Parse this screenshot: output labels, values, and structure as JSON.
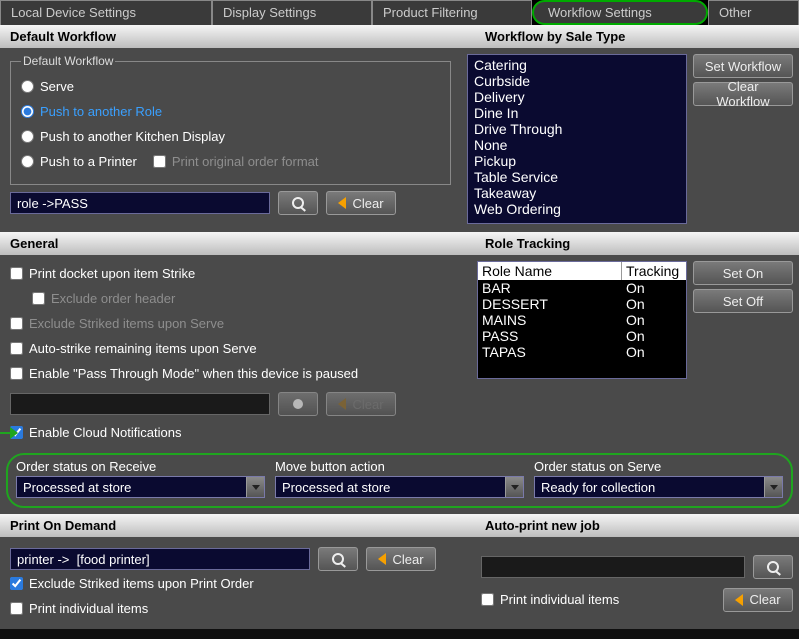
{
  "tabs": {
    "t0": "Local Device Settings",
    "t1": "Display Settings",
    "t2": "Product Filtering",
    "t3": "Workflow Settings",
    "t4": "Other"
  },
  "headers": {
    "default_workflow": "Default Workflow",
    "workflow_by_sale_type": "Workflow by Sale Type",
    "general": "General",
    "role_tracking": "Role Tracking",
    "print_on_demand": "Print On Demand",
    "auto_print_new_job": "Auto-print new job"
  },
  "default_workflow": {
    "legend": "Default Workflow",
    "serve": "Serve",
    "push_role": "Push to another Role",
    "push_kds": "Push to another Kitchen Display",
    "push_printer": "Push to a Printer",
    "print_original": "Print original order format",
    "role_value": "role ->PASS",
    "clear": "Clear"
  },
  "sale_types": {
    "items": [
      "Catering",
      "Curbside",
      "Delivery",
      "Dine In",
      "Drive Through",
      "None",
      "Pickup",
      "Table Service",
      "Takeaway",
      "Web Ordering"
    ],
    "set_workflow": "Set Workflow",
    "clear_workflow": "Clear Workflow"
  },
  "general": {
    "print_docket": "Print docket upon item Strike",
    "exclude_header": "Exclude order header",
    "exclude_striked_serve": "Exclude Striked items upon Serve",
    "auto_strike": "Auto-strike remaining items upon Serve",
    "pass_through": "Enable \"Pass Through Mode\" when this device is paused",
    "enable_cloud": "Enable Cloud Notifications",
    "clear": "Clear",
    "status_receive_label": "Order status on Receive",
    "status_receive_value": "Processed at store",
    "move_action_label": "Move button action",
    "move_action_value": "Processed at store",
    "status_serve_label": "Order status on Serve",
    "status_serve_value": "Ready for collection"
  },
  "role_tracking": {
    "col_name": "Role Name",
    "col_tracking": "Tracking",
    "rows": [
      {
        "name": "BAR",
        "tracking": "On"
      },
      {
        "name": "DESSERT",
        "tracking": "On"
      },
      {
        "name": "MAINS",
        "tracking": "On"
      },
      {
        "name": "PASS",
        "tracking": "On"
      },
      {
        "name": "TAPAS",
        "tracking": "On"
      }
    ],
    "set_on": "Set On",
    "set_off": "Set Off"
  },
  "print_on_demand": {
    "printer_value": "printer ->  [food printer]",
    "exclude_striked": "Exclude Striked items upon Print Order",
    "print_individual": "Print individual items",
    "clear": "Clear"
  },
  "auto_print": {
    "print_individual": "Print individual items",
    "clear": "Clear"
  }
}
